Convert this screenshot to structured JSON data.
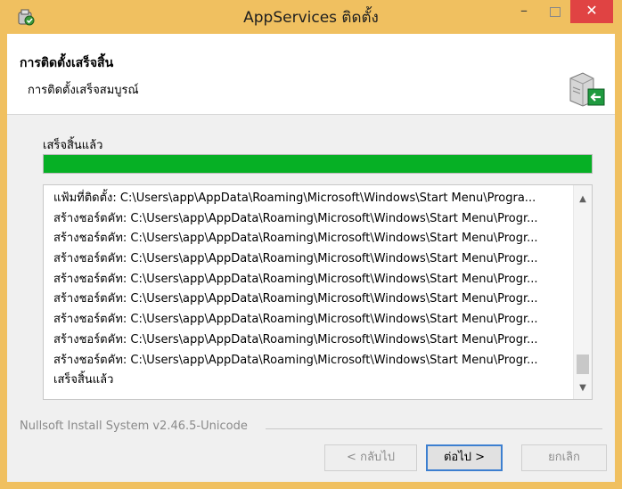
{
  "window": {
    "title": "AppServices ติดตั้ง",
    "minimize_label": "–",
    "close_label": "✕"
  },
  "header": {
    "title": "การติดตั้งเสร็จสิ้น",
    "subtitle": "การติดตั้งเสร็จสมบูรณ์"
  },
  "progress": {
    "status": "เสร็จสิ้นแล้ว",
    "percent": 100,
    "color": "#06b025"
  },
  "log": {
    "lines": [
      "แฟ้มที่ติดตั้ง: C:\\Users\\app\\AppData\\Roaming\\Microsoft\\Windows\\Start Menu\\Progra...",
      "สร้างชอร์ตคัท: C:\\Users\\app\\AppData\\Roaming\\Microsoft\\Windows\\Start Menu\\Progr...",
      "สร้างชอร์ตคัท: C:\\Users\\app\\AppData\\Roaming\\Microsoft\\Windows\\Start Menu\\Progr...",
      "สร้างชอร์ตคัท: C:\\Users\\app\\AppData\\Roaming\\Microsoft\\Windows\\Start Menu\\Progr...",
      "สร้างชอร์ตคัท: C:\\Users\\app\\AppData\\Roaming\\Microsoft\\Windows\\Start Menu\\Progr...",
      "สร้างชอร์ตคัท: C:\\Users\\app\\AppData\\Roaming\\Microsoft\\Windows\\Start Menu\\Progr...",
      "สร้างชอร์ตคัท: C:\\Users\\app\\AppData\\Roaming\\Microsoft\\Windows\\Start Menu\\Progr...",
      "สร้างชอร์ตคัท: C:\\Users\\app\\AppData\\Roaming\\Microsoft\\Windows\\Start Menu\\Progr...",
      "สร้างชอร์ตคัท: C:\\Users\\app\\AppData\\Roaming\\Microsoft\\Windows\\Start Menu\\Progr...",
      "เสร็จสิ้นแล้ว"
    ]
  },
  "footer": {
    "brand": "Nullsoft Install System v2.46.5-Unicode",
    "back_label": "< กลับไป",
    "next_label": "ต่อไป >",
    "cancel_label": "ยกเลิก"
  },
  "icons": {
    "app": "installer-app-icon",
    "header": "computer-install-icon"
  }
}
